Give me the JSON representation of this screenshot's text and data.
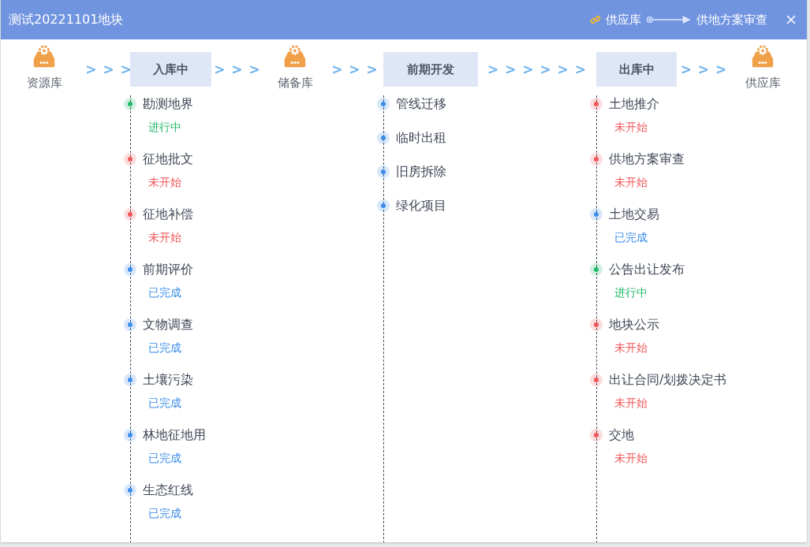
{
  "window": {
    "title": "测试20221101地块",
    "route_from": "供应库",
    "route_to": "供地方案审查"
  },
  "flow": [
    {
      "kind": "node",
      "label": "资源库"
    },
    {
      "kind": "arrows",
      "label": "> > >"
    },
    {
      "kind": "stage",
      "label": "入库中",
      "tasks": [
        {
          "name": "勘测地界",
          "color": "#1fb86a",
          "status_text": "进行中"
        },
        {
          "name": "征地批文",
          "color": "#f0575a",
          "status_text": "未开始"
        },
        {
          "name": "征地补偿",
          "color": "#f0575a",
          "status_text": "未开始"
        },
        {
          "name": "前期评价",
          "color": "#3c8ee8",
          "status_text": "已完成"
        },
        {
          "name": "文物调查",
          "color": "#3c8ee8",
          "status_text": "已完成"
        },
        {
          "name": "土壤污染",
          "color": "#3c8ee8",
          "status_text": "已完成"
        },
        {
          "name": "林地征地用",
          "color": "#3c8ee8",
          "status_text": "已完成"
        },
        {
          "name": "生态红线",
          "color": "#3c8ee8",
          "status_text": "已完成"
        }
      ]
    },
    {
      "kind": "arrows",
      "label": "> > >"
    },
    {
      "kind": "node",
      "label": "储备库"
    },
    {
      "kind": "arrows",
      "label": "> > >"
    },
    {
      "kind": "stage",
      "label": "前期开发",
      "tasks": [
        {
          "name": "管线迁移",
          "color": "#3c8ee8"
        },
        {
          "name": "临时出租",
          "color": "#3c8ee8"
        },
        {
          "name": "旧房拆除",
          "color": "#3c8ee8"
        },
        {
          "name": "绿化项目",
          "color": "#3c8ee8"
        }
      ]
    },
    {
      "kind": "arrows",
      "label": "> > > > > >"
    },
    {
      "kind": "stage",
      "label": "出库中",
      "tasks": [
        {
          "name": "土地推介",
          "color": "#f0575a",
          "status_text": "未开始"
        },
        {
          "name": "供地方案审查",
          "color": "#f0575a",
          "status_text": "未开始"
        },
        {
          "name": "土地交易",
          "color": "#3c8ee8",
          "status_text": "已完成"
        },
        {
          "name": "公告出让发布",
          "color": "#1fb86a",
          "status_text": "进行中"
        },
        {
          "name": "地块公示",
          "color": "#f0575a",
          "status_text": "未开始"
        },
        {
          "name": "出让合同/划拨决定书",
          "color": "#f0575a",
          "status_text": "未开始"
        },
        {
          "name": "交地",
          "color": "#f0575a",
          "status_text": "未开始"
        }
      ]
    },
    {
      "kind": "arrows",
      "label": "> > >"
    },
    {
      "kind": "node",
      "label": "供应库"
    }
  ]
}
